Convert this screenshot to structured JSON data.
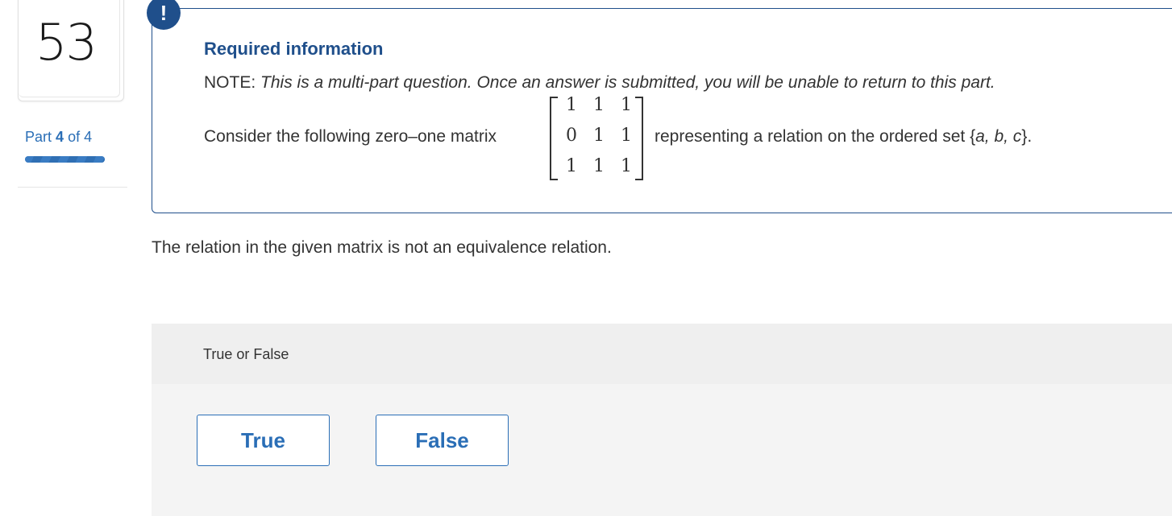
{
  "sidebar": {
    "question_number": "53",
    "part_prefix": "Part",
    "part_current": "4",
    "part_of_text": "of 4",
    "progress_fraction": 1.0
  },
  "info": {
    "badge": "!",
    "title": "Required information",
    "note_prefix": "NOTE:",
    "note_text": "This is a multi-part question. Once an answer is submitted, you will be unable to return to this part.",
    "consider_text": "Consider the following zero–one matrix",
    "matrix": [
      [
        "1",
        "1",
        "1"
      ],
      [
        "0",
        "1",
        "1"
      ],
      [
        "1",
        "1",
        "1"
      ]
    ],
    "representing_prefix": "representing a relation on the ordered set {",
    "set_elements": "a, b, c",
    "representing_suffix": "}."
  },
  "question": {
    "statement": "The relation in the given matrix is not an equivalence relation."
  },
  "answer": {
    "prompt": "True or False",
    "options": [
      "True",
      "False"
    ]
  },
  "colors": {
    "accent": "#2a6eb6",
    "dark_blue": "#1f4f8b",
    "panel_header": "#efefef",
    "panel_body": "#f4f4f4"
  }
}
